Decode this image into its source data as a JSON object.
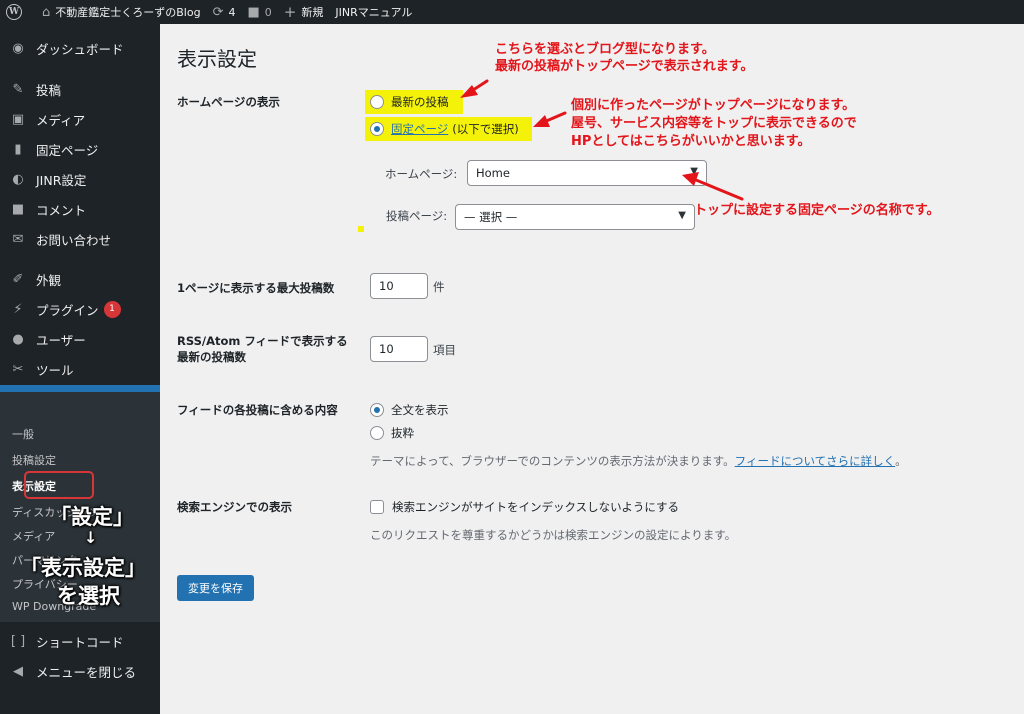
{
  "adminbar": {
    "site_name": "不動産鑑定士くろーずのBlog",
    "updates_count": "4",
    "comments_count": "0",
    "new_label": "新規",
    "manual_label": "JINRマニュアル"
  },
  "sidebar": {
    "dashboard": "ダッシュボード",
    "posts": "投稿",
    "media": "メディア",
    "pages": "固定ページ",
    "jinr": "JINR設定",
    "comments": "コメント",
    "contact": "お問い合わせ",
    "appearance": "外観",
    "plugins": "プラグイン",
    "plugins_badge": "1",
    "users": "ユーザー",
    "tools": "ツール",
    "settings": "設定",
    "submenu": {
      "general": "一般",
      "writing": "投稿設定",
      "reading": "表示設定",
      "discussion": "ディスカッション",
      "media": "メディア",
      "permalinks": "パーマリンク",
      "privacy": "プライバシー",
      "downgrade": "WP Downgrade"
    },
    "shortcode": "ショートコード",
    "collapse": "メニューを閉じる"
  },
  "overlay": {
    "line1": "「設定」",
    "arrow": "↓",
    "line2": "「表示設定」",
    "line3": "を選択"
  },
  "main": {
    "title": "表示設定",
    "homepage_display_label": "ホームページの表示",
    "latest_posts": "最新の投稿",
    "static_page_link": "固定ページ",
    "static_page_suffix": "(以下で選択)",
    "homepage_select_label": "ホームページ:",
    "homepage_select_value": "Home",
    "posts_page_label": "投稿ページ:",
    "posts_page_value": "— 選択 —",
    "per_page_label": "1ページに表示する最大投稿数",
    "per_page_value": "10",
    "per_page_unit": "件",
    "feed_label_1": "RSS/Atom フィードで表示する",
    "feed_label_2": "最新の投稿数",
    "feed_value": "10",
    "feed_unit": "項目",
    "feed_content_label": "フィードの各投稿に含める内容",
    "full_text": "全文を表示",
    "excerpt": "抜粋",
    "feed_desc": "テーマによって、ブラウザーでのコンテンツの表示方法が決まります。",
    "feed_link": "フィードについてさらに詳しく",
    "feed_desc_end": "。",
    "search_label": "検索エンジンでの表示",
    "search_checkbox": "検索エンジンがサイトをインデックスしないようにする",
    "search_desc": "このリクエストを尊重するかどうかは検索エンジンの設定によります。",
    "save_button": "変更を保存"
  },
  "annotations": {
    "a1_line1": "こちらを選ぶとブログ型になります。",
    "a1_line2": "最新の投稿がトップページで表示されます。",
    "a2_line1": "個別に作ったページがトップページになります。",
    "a2_line2": "屋号、サービス内容等をトップに表示できるので",
    "a2_line3": "HPとしてはこちらがいいかと思います。",
    "a3": "トップに設定する固定ページの名称です。"
  },
  "colors": {
    "admin_dark": "#1d2327",
    "accent": "#2271b1",
    "highlight": "#f5f20a",
    "annotation_red": "#e3151a",
    "badge_red": "#d63638"
  }
}
